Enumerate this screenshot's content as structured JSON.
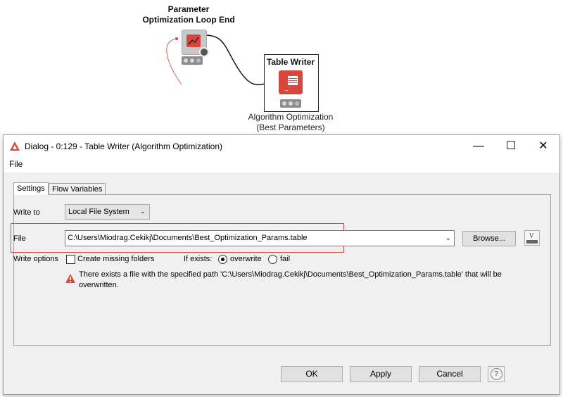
{
  "workflow": {
    "nodes": [
      {
        "title_line1": "Parameter",
        "title_line2": "Optimization Loop End"
      },
      {
        "title": "Table Writer",
        "caption_line1": "Algorithm Optimization",
        "caption_line2": "(Best Parameters)"
      }
    ]
  },
  "dialog": {
    "title": "Dialog - 0:129 - Table Writer (Algorithm Optimization)",
    "menu": {
      "file": "File"
    },
    "window_controls": {
      "minimize": "—",
      "maximize": "☐",
      "close": "✕"
    },
    "tabs": [
      {
        "label": "Settings",
        "active": true
      },
      {
        "label": "Flow Variables",
        "active": false
      }
    ],
    "write_to": {
      "label": "Write to",
      "value": "Local File System"
    },
    "file": {
      "label": "File",
      "value": "C:\\Users\\Miodrag.Cekikj\\Documents\\Best_Optimization_Params.table",
      "browse_label": "Browse..."
    },
    "write_options": {
      "label": "Write options",
      "create_missing_folders": {
        "label": "Create missing folders",
        "checked": false
      },
      "if_exists": {
        "label": "If exists:",
        "options": [
          {
            "label": "overwrite",
            "selected": true
          },
          {
            "label": "fail",
            "selected": false
          }
        ]
      }
    },
    "warning": {
      "icon": "warning-icon",
      "line1": "There exists a file with the specified path 'C:\\Users\\Miodrag.Cekikj\\Documents\\Best_Optimization_Params.table' that will be",
      "line2": "overwritten."
    },
    "buttons": {
      "ok": "OK",
      "apply": "Apply",
      "cancel": "Cancel",
      "help": "?"
    }
  },
  "colors": {
    "accent_red": "#e04545",
    "node_red": "#d9473c",
    "highlight_red": "#e04545"
  }
}
